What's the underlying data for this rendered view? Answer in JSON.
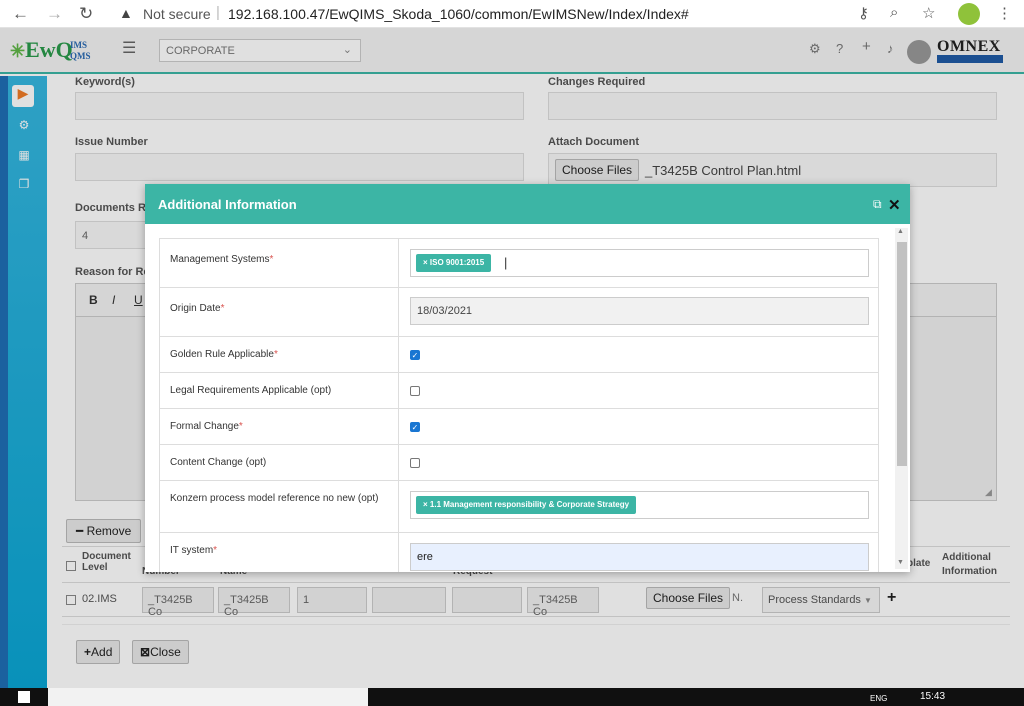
{
  "browser": {
    "not_secure": "Not secure",
    "url": "192.168.100.47/EwQIMS_Skoda_1060/common/EwIMSNew/Index/Index#"
  },
  "header": {
    "logo_main": "EwQ",
    "logo_sup": "IMS",
    "logo_sub": "QMS",
    "org_select": "CORPORATE",
    "brand": "OMNEX"
  },
  "form": {
    "keywords_label": "Keyword(s)",
    "changes_label": "Changes Required",
    "issue_label": "Issue Number",
    "attach_label": "Attach Document",
    "choose_files": "Choose Files",
    "attach_file": "_T3425B Control Plan.html",
    "documents_label": "Documents R",
    "documents_value": "4",
    "reason_label": "Reason for Re",
    "remove_btn": "Remove",
    "add_btn": "Add",
    "close_btn": "Close"
  },
  "grid": {
    "headers": [
      "Document Level",
      "Number",
      "Name",
      "Request",
      "plate",
      "Additional Information"
    ],
    "row": {
      "level": "02.IMS",
      "number": "_T3425B Co",
      "name": "_T3425B Co",
      "version": "1",
      "request_name": "_T3425B Co",
      "choose_files": "Choose Files",
      "file_short": "N.",
      "template": "Process Standards"
    }
  },
  "modal": {
    "title": "Additional Information",
    "rows": [
      {
        "label": "Management Systems",
        "required": "*",
        "tag": "ISO 9001:2015"
      },
      {
        "label": "Origin Date",
        "required": "*",
        "value": "18/03/2021"
      },
      {
        "label": "Golden Rule Applicable",
        "required": "*",
        "checked": true
      },
      {
        "label": "Legal Requirements Applicable (opt)",
        "checked": false
      },
      {
        "label": "Formal Change",
        "required": "*",
        "checked": true
      },
      {
        "label": "Content Change (opt)",
        "checked": false
      },
      {
        "label": "Konzern process model reference no new (opt)",
        "tag": "1.1 Management responsibility & Corporate Strategy"
      },
      {
        "label": "IT system",
        "required": "*",
        "value": "ere"
      }
    ]
  },
  "taskbar": {
    "time": "15:43",
    "lang": "ENG"
  }
}
